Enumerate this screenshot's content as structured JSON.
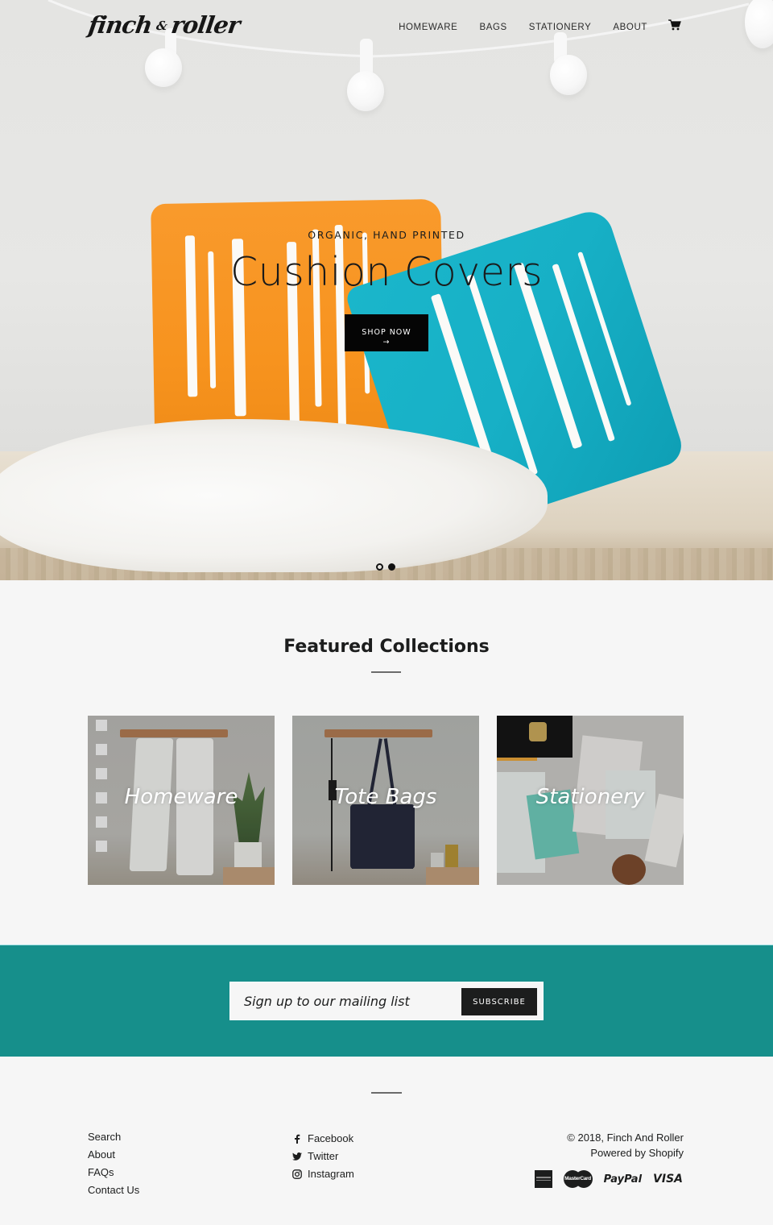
{
  "header": {
    "logo": {
      "left": "finch",
      "amp": "&",
      "right": "roller"
    },
    "nav": [
      {
        "label": "HOMEWARE"
      },
      {
        "label": "BAGS"
      },
      {
        "label": "STATIONERY"
      },
      {
        "label": "ABOUT"
      }
    ],
    "cart_icon": "cart-icon"
  },
  "hero": {
    "subtitle": "ORGANIC, HAND PRINTED",
    "title": "Cushion Covers",
    "button_label": "SHOP NOW",
    "button_arrow": "→",
    "slides": {
      "count": 2,
      "active": 2
    }
  },
  "featured": {
    "title": "Featured Collections",
    "collections": [
      {
        "label": "Homeware"
      },
      {
        "label": "Tote Bags"
      },
      {
        "label": "Stationery"
      }
    ]
  },
  "newsletter": {
    "placeholder": "Sign up to our mailing list",
    "button_label": "SUBSCRIBE",
    "bg_color": "#168f8b"
  },
  "footer": {
    "links": [
      {
        "label": "Search"
      },
      {
        "label": "About"
      },
      {
        "label": "FAQs"
      },
      {
        "label": "Contact Us"
      }
    ],
    "social": [
      {
        "label": "Facebook",
        "icon": "facebook-icon"
      },
      {
        "label": "Twitter",
        "icon": "twitter-icon"
      },
      {
        "label": "Instagram",
        "icon": "instagram-icon"
      }
    ],
    "copyright": "© 2018, Finch And Roller",
    "powered_by": "Powered by Shopify",
    "payments": [
      {
        "name": "American Express",
        "icon": "amex-icon"
      },
      {
        "name": "MasterCard",
        "label": "MasterCard",
        "icon": "mastercard-icon"
      },
      {
        "name": "PayPal",
        "label": "PayPal",
        "icon": "paypal-icon"
      },
      {
        "name": "Visa",
        "label": "VISA",
        "icon": "visa-icon"
      }
    ]
  }
}
